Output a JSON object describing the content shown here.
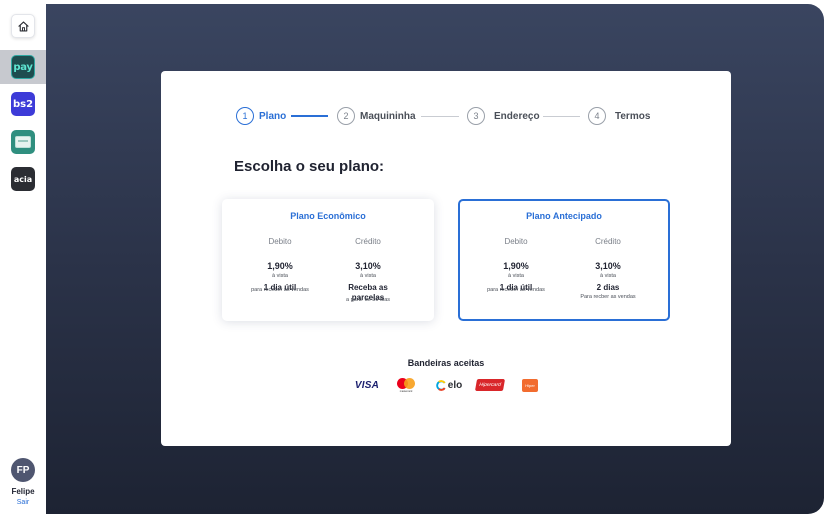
{
  "sidebar": {
    "items": [
      {
        "name": "home",
        "icon": "home-icon"
      },
      {
        "name": "pay",
        "label": "pay",
        "active": true
      },
      {
        "name": "bs2",
        "label": "bs2"
      },
      {
        "name": "card",
        "icon": "card-icon"
      },
      {
        "name": "acia",
        "label": "acia"
      }
    ],
    "user": {
      "initials": "FP",
      "name": "Felipe",
      "logout": "Sair"
    }
  },
  "stepper": {
    "steps": [
      {
        "number": "1",
        "label": "Plano",
        "active": true
      },
      {
        "number": "2",
        "label": "Maquininha",
        "active": false
      },
      {
        "number": "3",
        "label": "Endereço",
        "active": false
      },
      {
        "number": "4",
        "label": "Termos",
        "active": false
      }
    ]
  },
  "title": "Escolha o seu plano:",
  "plans": [
    {
      "title": "Plano Econômico",
      "selected": false,
      "debit": {
        "label": "Debito",
        "rate": "1,90%",
        "rate_note": "à vista",
        "term": "1 dia útil",
        "term_note": "para receber as vendas"
      },
      "credit": {
        "label": "Crédito",
        "rate": "3,10%",
        "rate_note": "à vista",
        "term": "Receba as parcelas",
        "term_note": "a partir de 30 dias"
      }
    },
    {
      "title": "Plano Antecipado",
      "selected": true,
      "debit": {
        "label": "Debito",
        "rate": "1,90%",
        "rate_note": "à vista",
        "term": "1 dia útil",
        "term_note": "para receber as vendas"
      },
      "credit": {
        "label": "Crédito",
        "rate": "3,10%",
        "rate_note": "à vista",
        "term": "2 dias",
        "term_note": "Para recber as vendas"
      }
    }
  ],
  "brands": {
    "title": "Bandeiras aceitas",
    "items": [
      {
        "name": "visa",
        "label": "VISA"
      },
      {
        "name": "mastercard",
        "label": "mastercard"
      },
      {
        "name": "elo",
        "label": "elo"
      },
      {
        "name": "hipercard",
        "label": "Hipercard"
      },
      {
        "name": "hiper",
        "label": "Hiper"
      }
    ]
  },
  "colors": {
    "accent": "#2a6fd6",
    "background_dark": "#2b3349",
    "mc_red": "#eb001b",
    "mc_yellow": "#f79e1b"
  }
}
